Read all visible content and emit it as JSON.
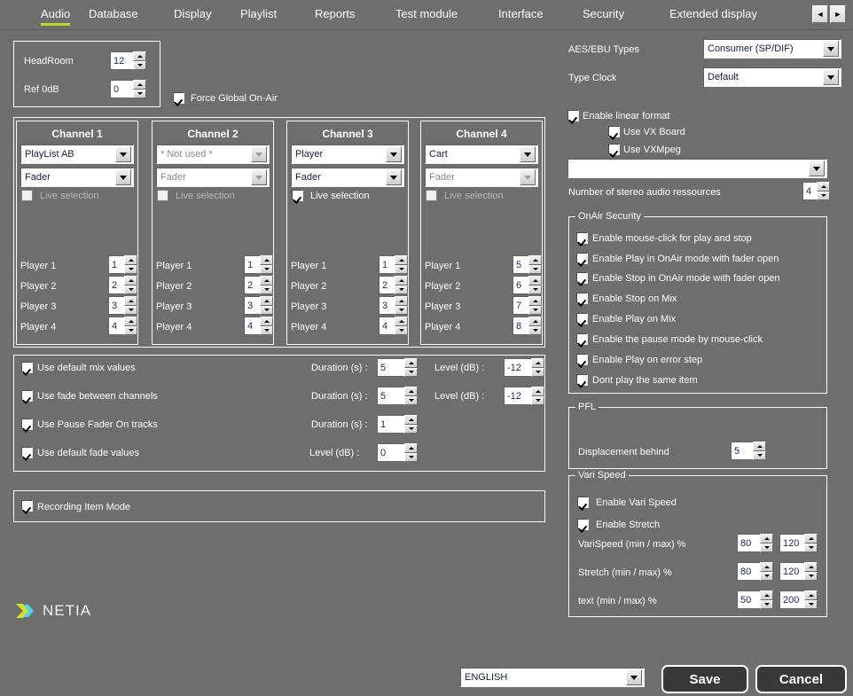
{
  "window": {
    "bg_color": "#6e6e6e",
    "accent_color": "#c6d42a"
  },
  "tabs": {
    "items": [
      {
        "label": "Audio",
        "active": true
      },
      {
        "label": "Database",
        "active": false
      },
      {
        "label": "Display",
        "active": false
      },
      {
        "label": "Playlist",
        "active": false
      },
      {
        "label": "Reports",
        "active": false
      },
      {
        "label": "Test module",
        "active": false
      },
      {
        "label": "Interface",
        "active": false
      },
      {
        "label": "Security",
        "active": false
      },
      {
        "label": "Extended display",
        "active": false
      }
    ],
    "nav_prev_icon": "chevron-left-icon",
    "nav_next_icon": "chevron-right-icon",
    "nav_prev_glyph": "◄",
    "nav_next_glyph": "►"
  },
  "headroom": {
    "headroom_label": "HeadRoom",
    "headroom_value": "12",
    "ref_label": "Ref  0dB",
    "ref_value": "0"
  },
  "force_global": {
    "label": "Force Global On-Air",
    "checked": true
  },
  "channels": [
    {
      "title": "Channel 1",
      "source": "PlayList AB",
      "source_disabled": false,
      "mode": "Fader",
      "mode_disabled": false,
      "live_selection_label": "Live selection",
      "live_selection_checked": false,
      "live_selection_disabled": true,
      "players": [
        {
          "label": "Player 1",
          "value": "1"
        },
        {
          "label": "Player 2",
          "value": "2"
        },
        {
          "label": "Player 3",
          "value": "3"
        },
        {
          "label": "Player  4",
          "value": "4"
        }
      ]
    },
    {
      "title": "Channel 2",
      "source": "* Not used *",
      "source_disabled": true,
      "mode": "Fader",
      "mode_disabled": true,
      "live_selection_label": "Live selection",
      "live_selection_checked": false,
      "live_selection_disabled": true,
      "players": [
        {
          "label": "Player 1",
          "value": "1"
        },
        {
          "label": "Player 2",
          "value": "2"
        },
        {
          "label": "Player 3",
          "value": "3"
        },
        {
          "label": "Player  4",
          "value": "4"
        }
      ]
    },
    {
      "title": "Channel 3",
      "source": "Player",
      "source_disabled": false,
      "mode": "Fader",
      "mode_disabled": false,
      "live_selection_label": "Live selection",
      "live_selection_checked": true,
      "live_selection_disabled": false,
      "players": [
        {
          "label": "Player 1",
          "value": "1"
        },
        {
          "label": "Player 2",
          "value": "2"
        },
        {
          "label": "Player 3",
          "value": "3"
        },
        {
          "label": "Player  4",
          "value": "4"
        }
      ]
    },
    {
      "title": "Channel 4",
      "source": "Cart",
      "source_disabled": false,
      "mode": "Fader",
      "mode_disabled": true,
      "live_selection_label": "Live selection",
      "live_selection_checked": false,
      "live_selection_disabled": true,
      "players": [
        {
          "label": "Player 1",
          "value": "5"
        },
        {
          "label": "Player 2",
          "value": "6"
        },
        {
          "label": "Player 3",
          "value": "7"
        },
        {
          "label": "Player  4",
          "value": "8"
        }
      ]
    }
  ],
  "mix": {
    "duration_label": "Duration (s) :",
    "level_label": "Level (dB)  :",
    "rows": [
      {
        "checkbox_label": "Use default mix values",
        "checked": true,
        "duration": "5",
        "level": "-12",
        "has_duration": true,
        "has_level": true
      },
      {
        "checkbox_label": "Use fade between channels",
        "checked": true,
        "duration": "5",
        "level": "-12",
        "has_duration": true,
        "has_level": true
      },
      {
        "checkbox_label": "Use Pause Fader On tracks",
        "checked": true,
        "duration": "1",
        "level": "",
        "has_duration": true,
        "has_level": false
      },
      {
        "checkbox_label": "Use default fade values",
        "checked": true,
        "duration": "",
        "level": "0",
        "has_duration": false,
        "has_level": true
      }
    ]
  },
  "recording": {
    "label": "Recording Item Mode",
    "checked": true
  },
  "logo": {
    "text": "NETIA",
    "icon": "netia-chevron-logo",
    "color_green": "#d4e02a",
    "color_cyan": "#4fd2e8"
  },
  "aes": {
    "types_label": "AES/EBU Types",
    "types_value": "Consumer (SP/DIF)",
    "clock_label": "Type Clock",
    "clock_value": "Default"
  },
  "linear": {
    "enable_label": "Enable linear format",
    "enable_checked": true,
    "vx_board_label": "Use VX Board",
    "vx_board_checked": true,
    "vxmpeg_label": "Use VXMpeg",
    "vxmpeg_checked": true,
    "board_combo_value": "",
    "stereo_label": "Number of stereo audio ressources",
    "stereo_value": "4"
  },
  "onair_security": {
    "title": "OnAir Security",
    "items": [
      {
        "label": "Enable mouse-click for play and stop",
        "checked": true
      },
      {
        "label": "Enable Play in OnAir mode with fader open",
        "checked": true
      },
      {
        "label": "Enable Stop in OnAir mode with fader open",
        "checked": true
      },
      {
        "label": "Enable Stop on Mix",
        "checked": true
      },
      {
        "label": "Enable Play on Mix",
        "checked": true
      },
      {
        "label": "Enable the pause mode by mouse-click",
        "checked": true
      },
      {
        "label": "Enable Play on error step",
        "checked": true
      },
      {
        "label": "Dont play the same item",
        "checked": true
      }
    ]
  },
  "pfl": {
    "title": "PFL",
    "displacement_label": "Displacement behind",
    "displacement_value": "5"
  },
  "vari_speed": {
    "title": "Vari Speed",
    "enable_vari_label": "Enable Vari Speed",
    "enable_vari_checked": true,
    "enable_stretch_label": "Enable Stretch",
    "enable_stretch_checked": true,
    "rows": [
      {
        "label": "VariSpeed (min / max) %",
        "min": "80",
        "max": "120"
      },
      {
        "label": "Stretch (min / max) %",
        "min": "80",
        "max": "120"
      },
      {
        "label": "text (min / max) %",
        "min": "50",
        "max": "200"
      }
    ]
  },
  "footer": {
    "language_value": "ENGLISH",
    "save_label": "Save",
    "cancel_label": "Cancel"
  }
}
